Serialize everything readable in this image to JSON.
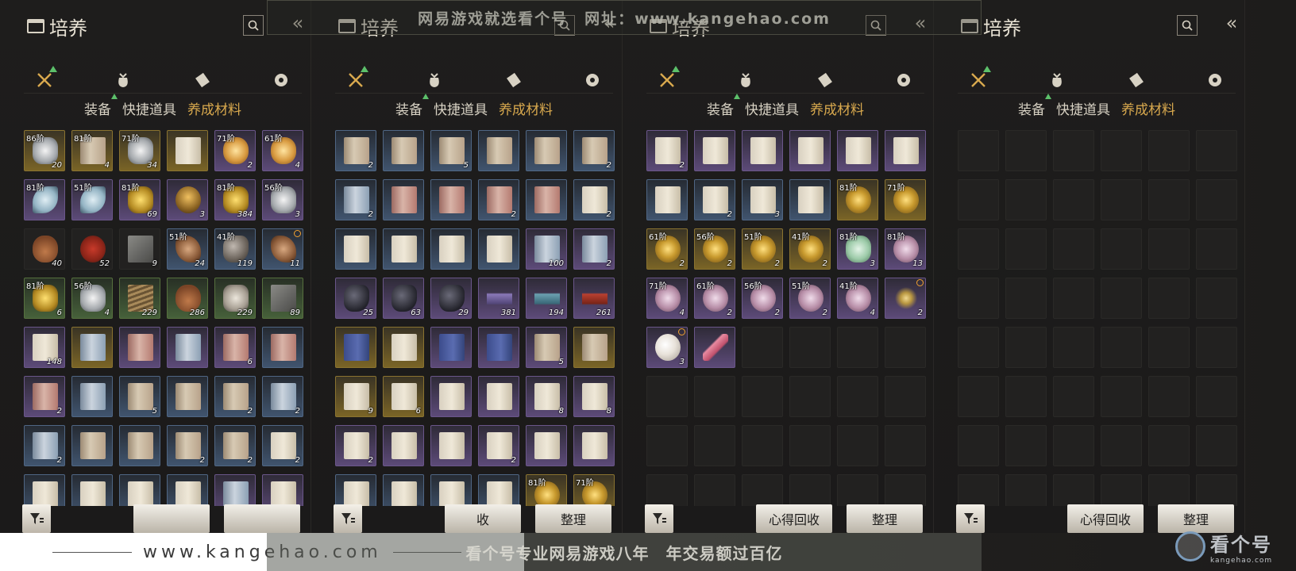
{
  "watermark": {
    "top": "网易游戏就选看个号　网址：www.kangehao.com",
    "bottom_url": "www.kangehao.com",
    "slogan": "看个号专业网易游戏八年　年交易额过百亿",
    "logo_main": "看个号",
    "logo_sub": "kangehao.com"
  },
  "panels": [
    {
      "title": "培养",
      "tabs": [
        "装备",
        "快捷道具",
        "养成材料"
      ],
      "active_tab": 2,
      "buttons": {
        "left": "",
        "right": ""
      },
      "items": [
        {
          "r": "gold",
          "art": "silver",
          "tier": "86阶",
          "qty": "20"
        },
        {
          "r": "gold",
          "art": "scroll",
          "tier": "81阶",
          "qty": "4"
        },
        {
          "r": "gold",
          "art": "silver",
          "tier": "71阶",
          "qty": "34"
        },
        {
          "r": "gold",
          "art": "book",
          "tier": "",
          "qty": ""
        },
        {
          "r": "purple",
          "art": "flower",
          "tier": "71阶",
          "qty": "2"
        },
        {
          "r": "purple",
          "art": "flower",
          "tier": "61阶",
          "qty": "4"
        },
        {
          "r": "purple",
          "art": "leaf",
          "tier": "81阶",
          "qty": ""
        },
        {
          "r": "purple",
          "art": "leaf",
          "tier": "51阶",
          "qty": ""
        },
        {
          "r": "purple",
          "art": "gold-nugget",
          "tier": "81阶",
          "qty": "69"
        },
        {
          "r": "purple",
          "art": "pot",
          "tier": "",
          "qty": "3"
        },
        {
          "r": "purple",
          "art": "gold-nugget",
          "tier": "81阶",
          "qty": "384"
        },
        {
          "r": "purple",
          "art": "silver",
          "tier": "56阶",
          "qty": "3"
        },
        {
          "r": "empty",
          "art": "gourd",
          "tier": "",
          "qty": "40"
        },
        {
          "r": "empty",
          "art": "sauce",
          "tier": "",
          "qty": "52"
        },
        {
          "r": "empty",
          "art": "cube",
          "tier": "",
          "qty": "9"
        },
        {
          "r": "blue",
          "art": "claw",
          "tier": "51阶",
          "qty": "24"
        },
        {
          "r": "blue",
          "art": "ore",
          "tier": "41阶",
          "qty": "119"
        },
        {
          "r": "blue",
          "art": "claw",
          "tier": "",
          "qty": "11",
          "target": true
        },
        {
          "r": "green",
          "art": "gold-nugget",
          "tier": "81阶",
          "qty": "6"
        },
        {
          "r": "green",
          "art": "silver",
          "tier": "56阶",
          "qty": "4"
        },
        {
          "r": "green",
          "art": "wood",
          "tier": "",
          "qty": "229"
        },
        {
          "r": "green",
          "art": "gourd",
          "tier": "",
          "qty": "286"
        },
        {
          "r": "green",
          "art": "grain",
          "tier": "",
          "qty": "229"
        },
        {
          "r": "green",
          "art": "cube",
          "tier": "",
          "qty": "89"
        },
        {
          "r": "purple",
          "art": "book",
          "tier": "",
          "qty": "148"
        },
        {
          "r": "gold",
          "art": "scroll-blue",
          "tier": "",
          "qty": ""
        },
        {
          "r": "purple",
          "art": "scroll-red",
          "tier": "",
          "qty": ""
        },
        {
          "r": "purple",
          "art": "scroll-blue",
          "tier": "",
          "qty": ""
        },
        {
          "r": "purple",
          "art": "scroll-red",
          "tier": "",
          "qty": "6"
        },
        {
          "r": "blue",
          "art": "scroll-red",
          "tier": "",
          "qty": ""
        },
        {
          "r": "purple",
          "art": "scroll-red",
          "tier": "",
          "qty": "2"
        },
        {
          "r": "blue",
          "art": "scroll-blue",
          "tier": "",
          "qty": ""
        },
        {
          "r": "blue",
          "art": "scroll",
          "tier": "",
          "qty": "5"
        },
        {
          "r": "blue",
          "art": "scroll",
          "tier": "",
          "qty": ""
        },
        {
          "r": "blue",
          "art": "scroll",
          "tier": "",
          "qty": "2"
        },
        {
          "r": "blue",
          "art": "scroll-blue",
          "tier": "",
          "qty": "2"
        },
        {
          "r": "blue",
          "art": "scroll-blue",
          "tier": "",
          "qty": "2"
        },
        {
          "r": "blue",
          "art": "scroll",
          "tier": "",
          "qty": ""
        },
        {
          "r": "blue",
          "art": "scroll",
          "tier": "",
          "qty": ""
        },
        {
          "r": "blue",
          "art": "scroll",
          "tier": "",
          "qty": "2"
        },
        {
          "r": "blue",
          "art": "scroll",
          "tier": "",
          "qty": "2"
        },
        {
          "r": "blue",
          "art": "book",
          "tier": "",
          "qty": "2"
        },
        {
          "r": "blue",
          "art": "book",
          "tier": "",
          "qty": ""
        },
        {
          "r": "blue",
          "art": "book",
          "tier": "",
          "qty": ""
        },
        {
          "r": "blue",
          "art": "book",
          "tier": "",
          "qty": ""
        },
        {
          "r": "blue",
          "art": "book",
          "tier": "",
          "qty": ""
        },
        {
          "r": "purple",
          "art": "scroll-blue",
          "tier": "",
          "qty": ""
        },
        {
          "r": "purple",
          "art": "book",
          "tier": "",
          "qty": ""
        }
      ]
    },
    {
      "title": "培养",
      "tabs": [
        "装备",
        "快捷道具",
        "养成材料"
      ],
      "active_tab": 2,
      "buttons": {
        "left": "收",
        "right": "整理"
      },
      "items": [
        {
          "r": "blue",
          "art": "scroll",
          "tier": "",
          "qty": "2"
        },
        {
          "r": "blue",
          "art": "scroll",
          "tier": "",
          "qty": ""
        },
        {
          "r": "blue",
          "art": "scroll",
          "tier": "",
          "qty": "5"
        },
        {
          "r": "blue",
          "art": "scroll",
          "tier": "",
          "qty": ""
        },
        {
          "r": "blue",
          "art": "scroll",
          "tier": "",
          "qty": ""
        },
        {
          "r": "blue",
          "art": "scroll",
          "tier": "",
          "qty": "2"
        },
        {
          "r": "blue",
          "art": "scroll-blue",
          "tier": "",
          "qty": "2"
        },
        {
          "r": "blue",
          "art": "scroll-red",
          "tier": "",
          "qty": ""
        },
        {
          "r": "blue",
          "art": "scroll-red",
          "tier": "",
          "qty": ""
        },
        {
          "r": "blue",
          "art": "scroll-red",
          "tier": "",
          "qty": "2"
        },
        {
          "r": "blue",
          "art": "scroll-red",
          "tier": "",
          "qty": ""
        },
        {
          "r": "blue",
          "art": "book",
          "tier": "",
          "qty": "2"
        },
        {
          "r": "blue",
          "art": "book",
          "tier": "",
          "qty": ""
        },
        {
          "r": "blue",
          "art": "book",
          "tier": "",
          "qty": ""
        },
        {
          "r": "blue",
          "art": "book",
          "tier": "",
          "qty": ""
        },
        {
          "r": "blue",
          "art": "book",
          "tier": "",
          "qty": ""
        },
        {
          "r": "purple",
          "art": "scroll-blue",
          "tier": "",
          "qty": "100"
        },
        {
          "r": "purple",
          "art": "scroll-blue",
          "tier": "",
          "qty": "2"
        },
        {
          "r": "purple",
          "art": "dark",
          "tier": "",
          "qty": "25"
        },
        {
          "r": "purple",
          "art": "dark",
          "tier": "",
          "qty": "63"
        },
        {
          "r": "purple",
          "art": "dark",
          "tier": "",
          "qty": "29"
        },
        {
          "r": "purple",
          "art": "bowlblue",
          "tier": "",
          "qty": "381"
        },
        {
          "r": "purple",
          "art": "tray",
          "tier": "",
          "qty": "194"
        },
        {
          "r": "purple",
          "art": "bowl",
          "tier": "",
          "qty": "261"
        },
        {
          "r": "gold",
          "art": "bookblue",
          "tier": "",
          "qty": ""
        },
        {
          "r": "gold",
          "art": "book",
          "tier": "",
          "qty": ""
        },
        {
          "r": "purple",
          "art": "bookblue",
          "tier": "",
          "qty": ""
        },
        {
          "r": "purple",
          "art": "bookblue",
          "tier": "",
          "qty": ""
        },
        {
          "r": "purple",
          "art": "scroll",
          "tier": "",
          "qty": "5"
        },
        {
          "r": "gold",
          "art": "scroll",
          "tier": "",
          "qty": ""
        },
        {
          "r": "gold",
          "art": "book",
          "tier": "",
          "qty": "9"
        },
        {
          "r": "gold",
          "art": "book",
          "tier": "",
          "qty": "6"
        },
        {
          "r": "purple",
          "art": "book",
          "tier": "",
          "qty": ""
        },
        {
          "r": "purple",
          "art": "book",
          "tier": "",
          "qty": ""
        },
        {
          "r": "purple",
          "art": "book",
          "tier": "",
          "qty": "8"
        },
        {
          "r": "purple",
          "art": "book",
          "tier": "",
          "qty": "8"
        },
        {
          "r": "purple",
          "art": "book",
          "tier": "",
          "qty": "2"
        },
        {
          "r": "purple",
          "art": "book",
          "tier": "",
          "qty": ""
        },
        {
          "r": "purple",
          "art": "book",
          "tier": "",
          "qty": ""
        },
        {
          "r": "purple",
          "art": "book",
          "tier": "",
          "qty": "2"
        },
        {
          "r": "purple",
          "art": "book",
          "tier": "",
          "qty": ""
        },
        {
          "r": "purple",
          "art": "book",
          "tier": "",
          "qty": ""
        },
        {
          "r": "blue",
          "art": "book",
          "tier": "",
          "qty": ""
        },
        {
          "r": "blue",
          "art": "book",
          "tier": "",
          "qty": "2"
        },
        {
          "r": "blue",
          "art": "book",
          "tier": "",
          "qty": "3"
        },
        {
          "r": "blue",
          "art": "book",
          "tier": "",
          "qty": ""
        },
        {
          "r": "gold",
          "art": "shell",
          "tier": "81阶",
          "qty": ""
        },
        {
          "r": "gold",
          "art": "shell",
          "tier": "71阶",
          "qty": ""
        }
      ]
    },
    {
      "title": "培养",
      "tabs": [
        "装备",
        "快捷道具",
        "养成材料"
      ],
      "active_tab": 2,
      "buttons": {
        "left": "心得回收",
        "right": "整理"
      },
      "items": [
        {
          "r": "purple",
          "art": "book",
          "tier": "",
          "qty": "2"
        },
        {
          "r": "purple",
          "art": "book",
          "tier": "",
          "qty": ""
        },
        {
          "r": "purple",
          "art": "book",
          "tier": "",
          "qty": ""
        },
        {
          "r": "purple",
          "art": "book",
          "tier": "",
          "qty": ""
        },
        {
          "r": "purple",
          "art": "book",
          "tier": "",
          "qty": ""
        },
        {
          "r": "purple",
          "art": "book",
          "tier": "",
          "qty": ""
        },
        {
          "r": "blue",
          "art": "book",
          "tier": "",
          "qty": ""
        },
        {
          "r": "blue",
          "art": "book",
          "tier": "",
          "qty": "2"
        },
        {
          "r": "blue",
          "art": "book",
          "tier": "",
          "qty": "3"
        },
        {
          "r": "blue",
          "art": "book",
          "tier": "",
          "qty": ""
        },
        {
          "r": "gold",
          "art": "shell",
          "tier": "81阶",
          "qty": ""
        },
        {
          "r": "gold",
          "art": "shell",
          "tier": "71阶",
          "qty": ""
        },
        {
          "r": "gold",
          "art": "shell",
          "tier": "61阶",
          "qty": "2"
        },
        {
          "r": "gold",
          "art": "shell",
          "tier": "56阶",
          "qty": "2"
        },
        {
          "r": "gold",
          "art": "shell",
          "tier": "51阶",
          "qty": "2"
        },
        {
          "r": "gold",
          "art": "shell",
          "tier": "41阶",
          "qty": "2"
        },
        {
          "r": "purple",
          "art": "jade",
          "tier": "81阶",
          "qty": "3"
        },
        {
          "r": "purple",
          "art": "shellpink",
          "tier": "81阶",
          "qty": "13"
        },
        {
          "r": "purple",
          "art": "shellpink",
          "tier": "71阶",
          "qty": "4"
        },
        {
          "r": "purple",
          "art": "shellpink",
          "tier": "61阶",
          "qty": "2"
        },
        {
          "r": "purple",
          "art": "shellpink",
          "tier": "56阶",
          "qty": "2"
        },
        {
          "r": "purple",
          "art": "shellpink",
          "tier": "51阶",
          "qty": "2"
        },
        {
          "r": "purple",
          "art": "shellpink",
          "tier": "41阶",
          "qty": "4"
        },
        {
          "r": "purple",
          "art": "dust",
          "tier": "",
          "qty": "2",
          "target": true
        },
        {
          "r": "purple",
          "art": "pearl",
          "tier": "",
          "qty": "3",
          "target": true
        },
        {
          "r": "purple",
          "art": "feather",
          "tier": "",
          "qty": ""
        }
      ]
    },
    {
      "title": "培养",
      "tabs": [
        "装备",
        "快捷道具",
        "养成材料"
      ],
      "active_tab": 2,
      "buttons": {
        "left": "心得回收",
        "right": "整理"
      },
      "items": []
    }
  ]
}
